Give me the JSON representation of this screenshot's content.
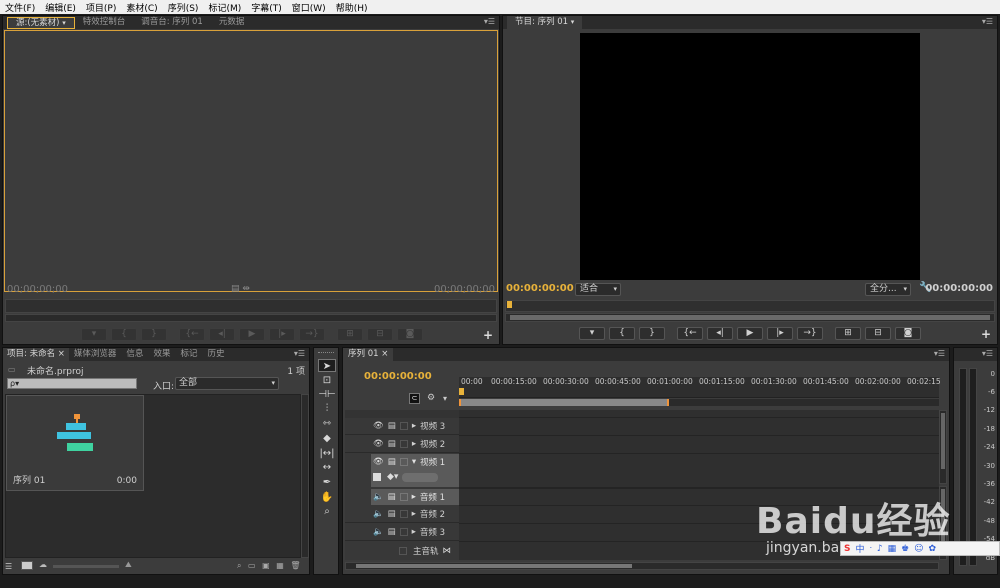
{
  "menu": [
    "文件(F)",
    "编辑(E)",
    "项目(P)",
    "素材(C)",
    "序列(S)",
    "标记(M)",
    "字幕(T)",
    "窗口(W)",
    "帮助(H)"
  ],
  "source_panel": {
    "tabs": [
      "源:(无素材)",
      "特效控制台",
      "调音台: 序列 01",
      "元数据"
    ],
    "timecode_left": "00;00;00;00",
    "timecode_right": "00;00;00;00"
  },
  "program_panel": {
    "tab": "节目: 序列 01",
    "timecode_left": "00:00:00:00",
    "fit": "适合",
    "resolution": "全分...",
    "timecode_right": "00:00:00:00"
  },
  "project_panel": {
    "tabs": [
      "项目: 未命名",
      "媒体浏览器",
      "信息",
      "效果",
      "标记",
      "历史"
    ],
    "count": "1 项",
    "filename": "未命名.prproj",
    "search_placeholder": "ρ▾",
    "entry_label": "入口:",
    "entry_value": "全部",
    "clip_name": "序列 01",
    "clip_duration": "0:00"
  },
  "timeline": {
    "tab": "序列 01",
    "timecode": "00:00:00:00",
    "ruler": [
      "00:00",
      "00:00:15:00",
      "00:00:30:00",
      "00:00:45:00",
      "00:01:00:00",
      "00:01:15:00",
      "00:01:30:00",
      "00:01:45:00",
      "00:02:00:00",
      "00:02:15"
    ],
    "video_tracks": [
      "视频 3",
      "视频 2",
      "视频 1"
    ],
    "audio_tracks": [
      "音频 1",
      "音频 2",
      "音频 3"
    ],
    "master_track": "主音轨"
  },
  "audio_meter": {
    "labels": [
      "0",
      "-6",
      "-12",
      "-18",
      "-24",
      "-30",
      "-36",
      "-42",
      "-48",
      "-54",
      "dB"
    ]
  },
  "watermark": {
    "logo": "Baidu经验",
    "url": "jingyan.baidu.com"
  }
}
